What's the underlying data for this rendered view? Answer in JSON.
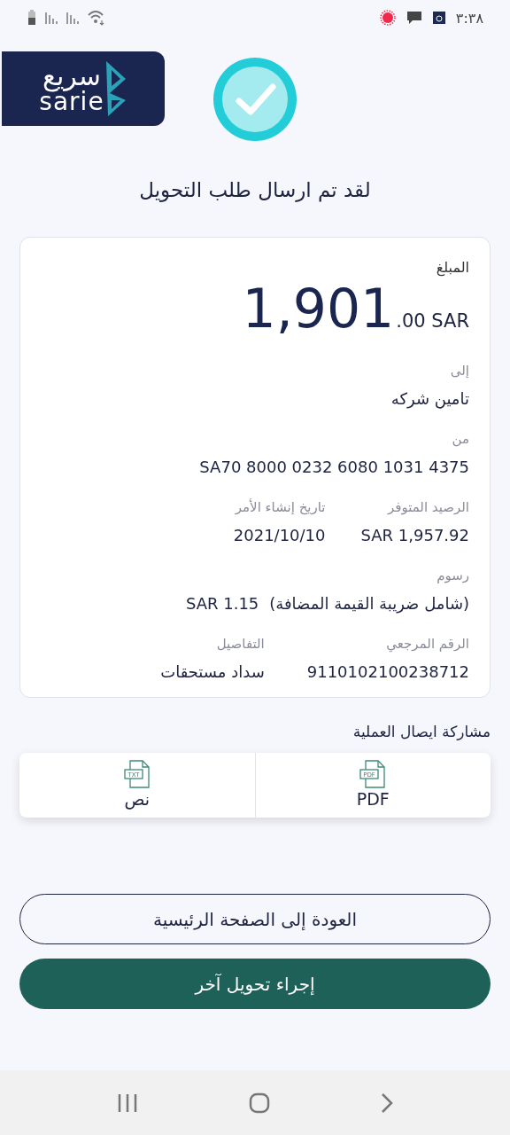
{
  "status_bar": {
    "time": "٣:٣٨"
  },
  "logo": {
    "arabic": "سريع",
    "latin": "sarie"
  },
  "title": "لقد تم ارسال طلب التحويل",
  "details": {
    "amount_label": "المبلغ",
    "amount_whole": "1,901",
    "amount_fraction": ".00 SAR",
    "to_label": "إلى",
    "to_value": "تامين شركه",
    "from_label": "من",
    "from_value": "SA70 8000 0232 6080 1031 4375",
    "fees_label": "رسوم",
    "fees_note": "(شامل ضريبة القيمة المضافة)",
    "fees_value": "SAR  1.15",
    "pair_rows": [
      [
        {
          "label": "الرصيد المتوفر",
          "value": "SAR 1,957.92"
        },
        {
          "label": "تاريخ إنشاء الأمر",
          "value": "2021/10/10"
        }
      ],
      [
        {
          "label": "الرقم المرجعي",
          "value": "9110102100238712"
        },
        {
          "label": "التفاصيل",
          "value": "سداد مستحقات"
        }
      ]
    ]
  },
  "share": {
    "title": "مشاركة ايصال العملية",
    "options": [
      {
        "icon_label": "PDF",
        "label": "PDF"
      },
      {
        "icon_label": "TXT",
        "label": "نص"
      }
    ]
  },
  "buttons": [
    {
      "kind": "outline",
      "label": "العودة إلى الصفحة الرئيسية"
    },
    {
      "kind": "filled",
      "label": "إجراء تحويل آخر"
    }
  ]
}
